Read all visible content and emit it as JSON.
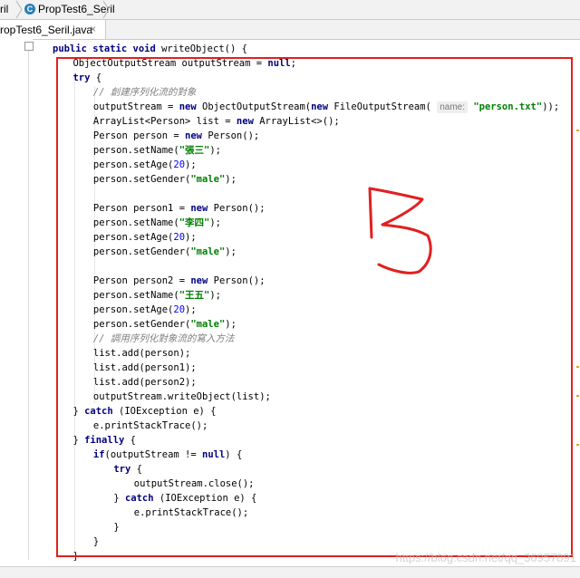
{
  "breadcrumb": {
    "items": [
      "ril",
      "PropTest6_Seril"
    ]
  },
  "editor_tab": {
    "label": "ropTest6_Seril.java",
    "close_glyph": "×"
  },
  "code_lines": [
    {
      "indent": 4,
      "tokens": [
        [
          "kw",
          "public static void "
        ],
        [
          "fn",
          "writeObject"
        ],
        [
          "",
          "() {"
        ]
      ]
    },
    {
      "indent": 8,
      "tokens": [
        [
          "",
          "ObjectOutputStream outputStream = "
        ],
        [
          "kw",
          "null"
        ],
        [
          "",
          ";"
        ]
      ]
    },
    {
      "indent": 8,
      "tokens": [
        [
          "kw",
          "try"
        ],
        [
          "",
          " {"
        ]
      ]
    },
    {
      "indent": 12,
      "tokens": [
        [
          "cmt",
          "// 創建序列化流的對象"
        ]
      ]
    },
    {
      "indent": 12,
      "tokens": [
        [
          "",
          "outputStream = "
        ],
        [
          "kw",
          "new "
        ],
        [
          "",
          "ObjectOutputStream("
        ],
        [
          "kw",
          "new "
        ],
        [
          "",
          "FileOutputStream( "
        ],
        [
          "hint",
          "name:"
        ],
        [
          "",
          " "
        ],
        [
          "str",
          "\"person.txt\""
        ],
        [
          "",
          "));"
        ]
      ]
    },
    {
      "indent": 12,
      "tokens": [
        [
          "",
          "ArrayList<Person> list = "
        ],
        [
          "kw",
          "new "
        ],
        [
          "",
          "ArrayList<>();"
        ]
      ]
    },
    {
      "indent": 12,
      "tokens": [
        [
          "",
          "Person person = "
        ],
        [
          "kw",
          "new "
        ],
        [
          "",
          "Person();"
        ]
      ]
    },
    {
      "indent": 12,
      "tokens": [
        [
          "",
          "person.setName("
        ],
        [
          "str",
          "\"張三\""
        ],
        [
          "",
          ");"
        ]
      ]
    },
    {
      "indent": 12,
      "tokens": [
        [
          "",
          "person.setAge("
        ],
        [
          "num",
          "20"
        ],
        [
          "",
          ");"
        ]
      ]
    },
    {
      "indent": 12,
      "tokens": [
        [
          "",
          "person.setGender("
        ],
        [
          "str",
          "\"male\""
        ],
        [
          "",
          ");"
        ]
      ]
    },
    {
      "indent": 0,
      "tokens": []
    },
    {
      "indent": 12,
      "tokens": [
        [
          "",
          "Person person1 = "
        ],
        [
          "kw",
          "new "
        ],
        [
          "",
          "Person();"
        ]
      ]
    },
    {
      "indent": 12,
      "tokens": [
        [
          "",
          "person.setName("
        ],
        [
          "str",
          "\"李四\""
        ],
        [
          "",
          ");"
        ]
      ]
    },
    {
      "indent": 12,
      "tokens": [
        [
          "",
          "person.setAge("
        ],
        [
          "num",
          "20"
        ],
        [
          "",
          ");"
        ]
      ]
    },
    {
      "indent": 12,
      "tokens": [
        [
          "",
          "person.setGender("
        ],
        [
          "str",
          "\"male\""
        ],
        [
          "",
          ");"
        ]
      ]
    },
    {
      "indent": 0,
      "tokens": []
    },
    {
      "indent": 12,
      "tokens": [
        [
          "",
          "Person person2 = "
        ],
        [
          "kw",
          "new "
        ],
        [
          "",
          "Person();"
        ]
      ]
    },
    {
      "indent": 12,
      "tokens": [
        [
          "",
          "person.setName("
        ],
        [
          "str",
          "\"王五\""
        ],
        [
          "",
          ");"
        ]
      ]
    },
    {
      "indent": 12,
      "tokens": [
        [
          "",
          "person.setAge("
        ],
        [
          "num",
          "20"
        ],
        [
          "",
          ");"
        ]
      ]
    },
    {
      "indent": 12,
      "tokens": [
        [
          "",
          "person.setGender("
        ],
        [
          "str",
          "\"male\""
        ],
        [
          "",
          ");"
        ]
      ]
    },
    {
      "indent": 12,
      "tokens": [
        [
          "cmt",
          "// 調用序列化對象流的寫入方法"
        ]
      ]
    },
    {
      "indent": 12,
      "tokens": [
        [
          "",
          "list.add(person);"
        ]
      ]
    },
    {
      "indent": 12,
      "tokens": [
        [
          "",
          "list.add(person1);"
        ]
      ]
    },
    {
      "indent": 12,
      "tokens": [
        [
          "",
          "list.add(person2);"
        ]
      ]
    },
    {
      "indent": 12,
      "tokens": [
        [
          "",
          "outputStream.writeObject(list);"
        ]
      ]
    },
    {
      "indent": 8,
      "tokens": [
        [
          "",
          "} "
        ],
        [
          "kw",
          "catch "
        ],
        [
          "",
          "(IOException e) {"
        ]
      ]
    },
    {
      "indent": 12,
      "tokens": [
        [
          "",
          "e.printStackTrace();"
        ]
      ]
    },
    {
      "indent": 8,
      "tokens": [
        [
          "",
          "} "
        ],
        [
          "kw",
          "finally"
        ],
        [
          "",
          " {"
        ]
      ]
    },
    {
      "indent": 12,
      "tokens": [
        [
          "kw",
          "if"
        ],
        [
          "",
          "(outputStream != "
        ],
        [
          "kw",
          "null"
        ],
        [
          "",
          ") {"
        ]
      ]
    },
    {
      "indent": 16,
      "tokens": [
        [
          "kw",
          "try"
        ],
        [
          "",
          " {"
        ]
      ]
    },
    {
      "indent": 20,
      "tokens": [
        [
          "",
          "outputStream.close();"
        ]
      ]
    },
    {
      "indent": 16,
      "tokens": [
        [
          "",
          "} "
        ],
        [
          "kw",
          "catch "
        ],
        [
          "",
          "(IOException e) {"
        ]
      ]
    },
    {
      "indent": 20,
      "tokens": [
        [
          "",
          "e.printStackTrace();"
        ]
      ]
    },
    {
      "indent": 16,
      "tokens": [
        [
          "",
          "}"
        ]
      ]
    },
    {
      "indent": 12,
      "tokens": [
        [
          "",
          "}"
        ]
      ]
    },
    {
      "indent": 8,
      "tokens": [
        [
          "",
          "}"
        ]
      ]
    }
  ],
  "annotation": {
    "color": "#e02020",
    "scribble_label": "handwritten number 3"
  },
  "watermark": "https://blog.csdn.net/qq_36957891",
  "colors": {
    "keyword": "#000080",
    "string": "#008000",
    "number": "#0000ff",
    "comment": "#808080",
    "highlight_box": "#e02020"
  }
}
